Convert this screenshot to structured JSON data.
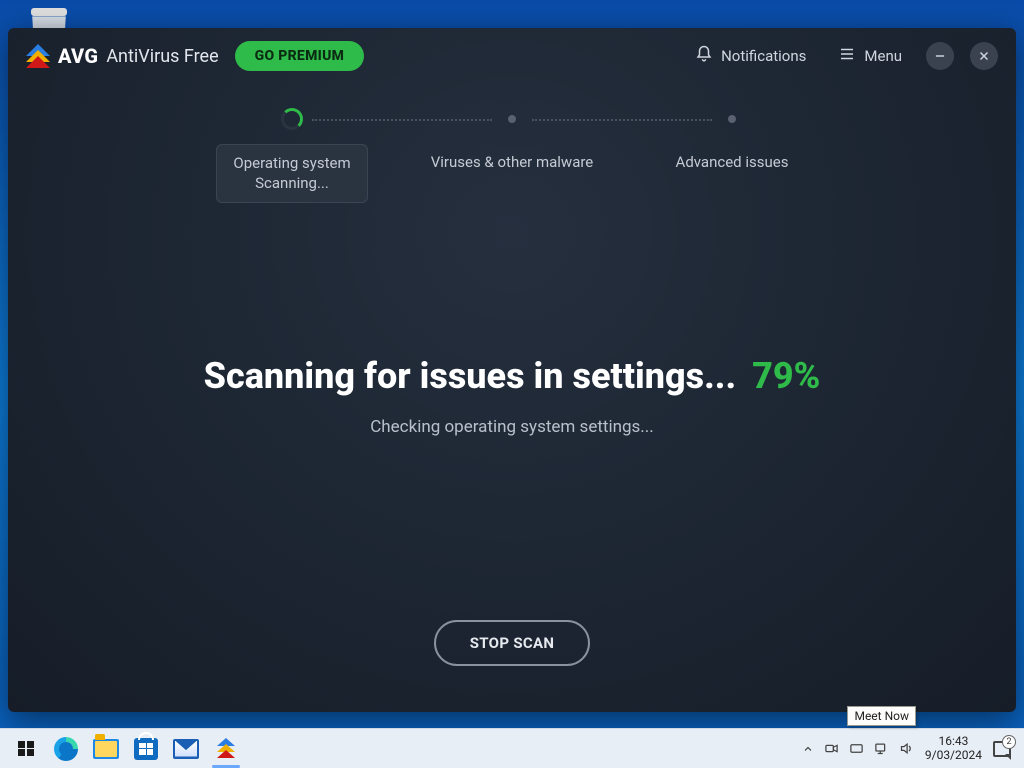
{
  "app": {
    "brand": "AVG",
    "product": "AntiVirus Free",
    "premium_button": "GO PREMIUM",
    "notifications_label": "Notifications",
    "menu_label": "Menu"
  },
  "steps": {
    "s1": {
      "title": "Operating system",
      "status": "Scanning..."
    },
    "s2": {
      "title": "Viruses & other malware"
    },
    "s3": {
      "title": "Advanced issues"
    }
  },
  "scan": {
    "headline": "Scanning for issues in settings...",
    "percent": "79%",
    "subtitle": "Checking operating system settings...",
    "stop_button": "STOP SCAN"
  },
  "taskbar": {
    "tooltip": "Meet Now",
    "time": "16:43",
    "date": "9/03/2024",
    "notif_badge": "2"
  }
}
